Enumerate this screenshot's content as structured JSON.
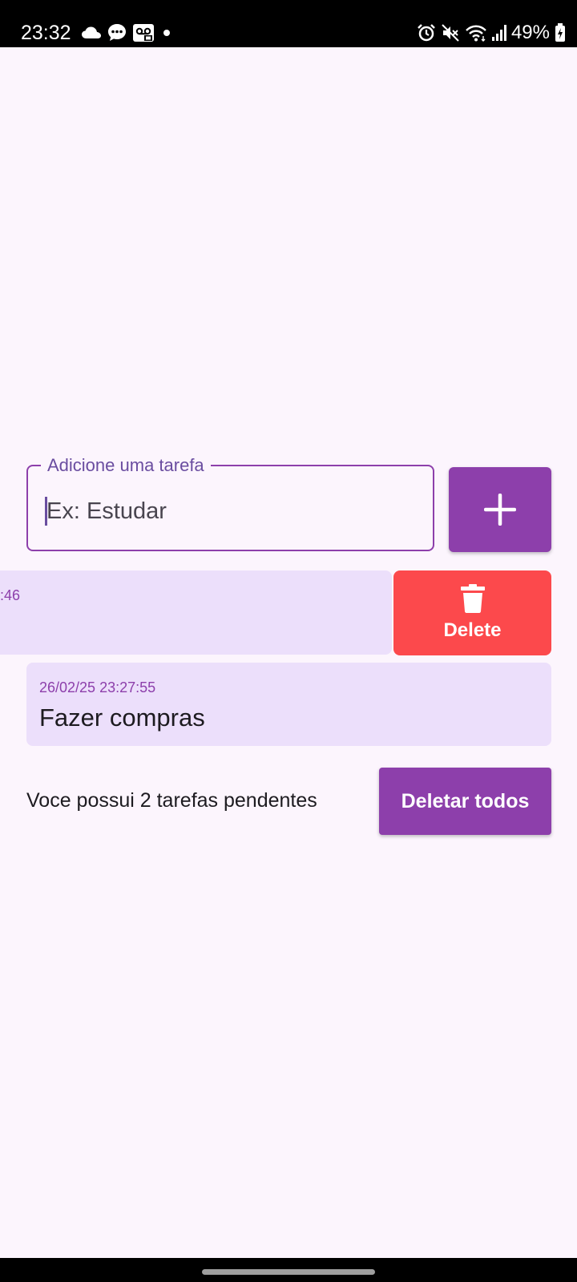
{
  "status_bar": {
    "time": "23:32",
    "battery": "49%",
    "left_icons": [
      "cloud-icon",
      "chat-icon",
      "voicemail-icon",
      "dot-icon"
    ],
    "right_icons": [
      "alarm-icon",
      "mute-icon",
      "wifi-icon",
      "signal-icon",
      "battery-icon"
    ]
  },
  "task_input": {
    "label": "Adicione uma tarefa",
    "placeholder": "Ex: Estudar",
    "value": ""
  },
  "add_button": {
    "icon": "plus-icon"
  },
  "tasks": [
    {
      "date_visible": ":46",
      "state": "swiped",
      "delete_label": "Delete",
      "delete_icon": "trash-icon"
    },
    {
      "date": "26/02/25 23:27:55",
      "title": "Fazer compras"
    }
  ],
  "footer": {
    "pending_text": "Voce possui 2 tarefas pendentes",
    "delete_all_label": "Deletar todos"
  },
  "colors": {
    "primary": "#8d3fab",
    "background": "#fcf5fd",
    "card": "#ecdffb",
    "delete": "#fc494c"
  }
}
